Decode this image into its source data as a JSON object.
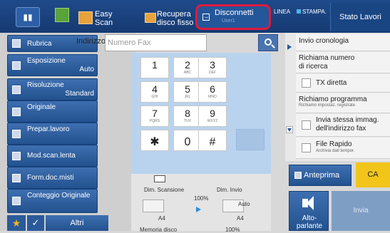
{
  "topbar": {
    "easy_scan": "Easy\nScan",
    "recupera": "Recupera\ndisco fisso",
    "disconnetti": "Disconnetti",
    "user": "User1",
    "linea": "LINEA",
    "stampa": "STAMPA.",
    "stato_lavori": "Stato Lavori"
  },
  "address": {
    "label": "Indirizzo",
    "placeholder": "Numero Fax"
  },
  "left_menu": [
    {
      "label": "Rubrica",
      "value": ""
    },
    {
      "label": "Esposizione",
      "value": "Auto"
    },
    {
      "label": "Risoluzione",
      "value": "Standard"
    },
    {
      "label": "Originale",
      "value": ""
    },
    {
      "label": "Prepar.lavoro",
      "value": ""
    },
    {
      "label": "Mod.scan.lenta",
      "value": ""
    },
    {
      "label": "Form.doc.misti",
      "value": ""
    },
    {
      "label": "Conteggio Originale",
      "value": ""
    }
  ],
  "bottom_left": {
    "altri": "Altri"
  },
  "keypad": [
    {
      "n": "1",
      "s": ""
    },
    {
      "n": "2",
      "s": "ABC"
    },
    {
      "n": "3",
      "s": "DEF"
    },
    {
      "n": "4",
      "s": "GHI"
    },
    {
      "n": "5",
      "s": "JKL"
    },
    {
      "n": "6",
      "s": "MNO"
    },
    {
      "n": "7",
      "s": "PQRS"
    },
    {
      "n": "8",
      "s": "TUV"
    },
    {
      "n": "9",
      "s": "WXYZ"
    },
    {
      "n": "✱",
      "s": ""
    },
    {
      "n": "0",
      "s": ""
    },
    {
      "n": "#",
      "s": ""
    }
  ],
  "scan_info": {
    "dim_scansione": "Dim. Scansione",
    "dim_invio": "Dim. Invio",
    "ratio": "100%",
    "auto": "Auto",
    "a4_left": "A4",
    "a4_right": "A4",
    "memoria": "Memoria disco",
    "memoria_pct": "100%"
  },
  "right_menu": {
    "invio_cronologia": "Invio cronologia",
    "richiama_numero": "Richiama numero\ndi ricerca",
    "tx_diretta": "TX diretta",
    "richiamo_programma": "Richiamo programma",
    "richiamo_sub": "Richiamo impostaz. registrate",
    "invia_stessa": "Invia stessa immag.\ndell'indirizzo fax",
    "file_rapido": "File Rapido",
    "file_rapido_sub": "Archivia dati tempor."
  },
  "actions": {
    "anteprima": "Anteprima",
    "ca": "CA",
    "altoparlante": "Alto-\nparlante",
    "invia": "Invia"
  }
}
